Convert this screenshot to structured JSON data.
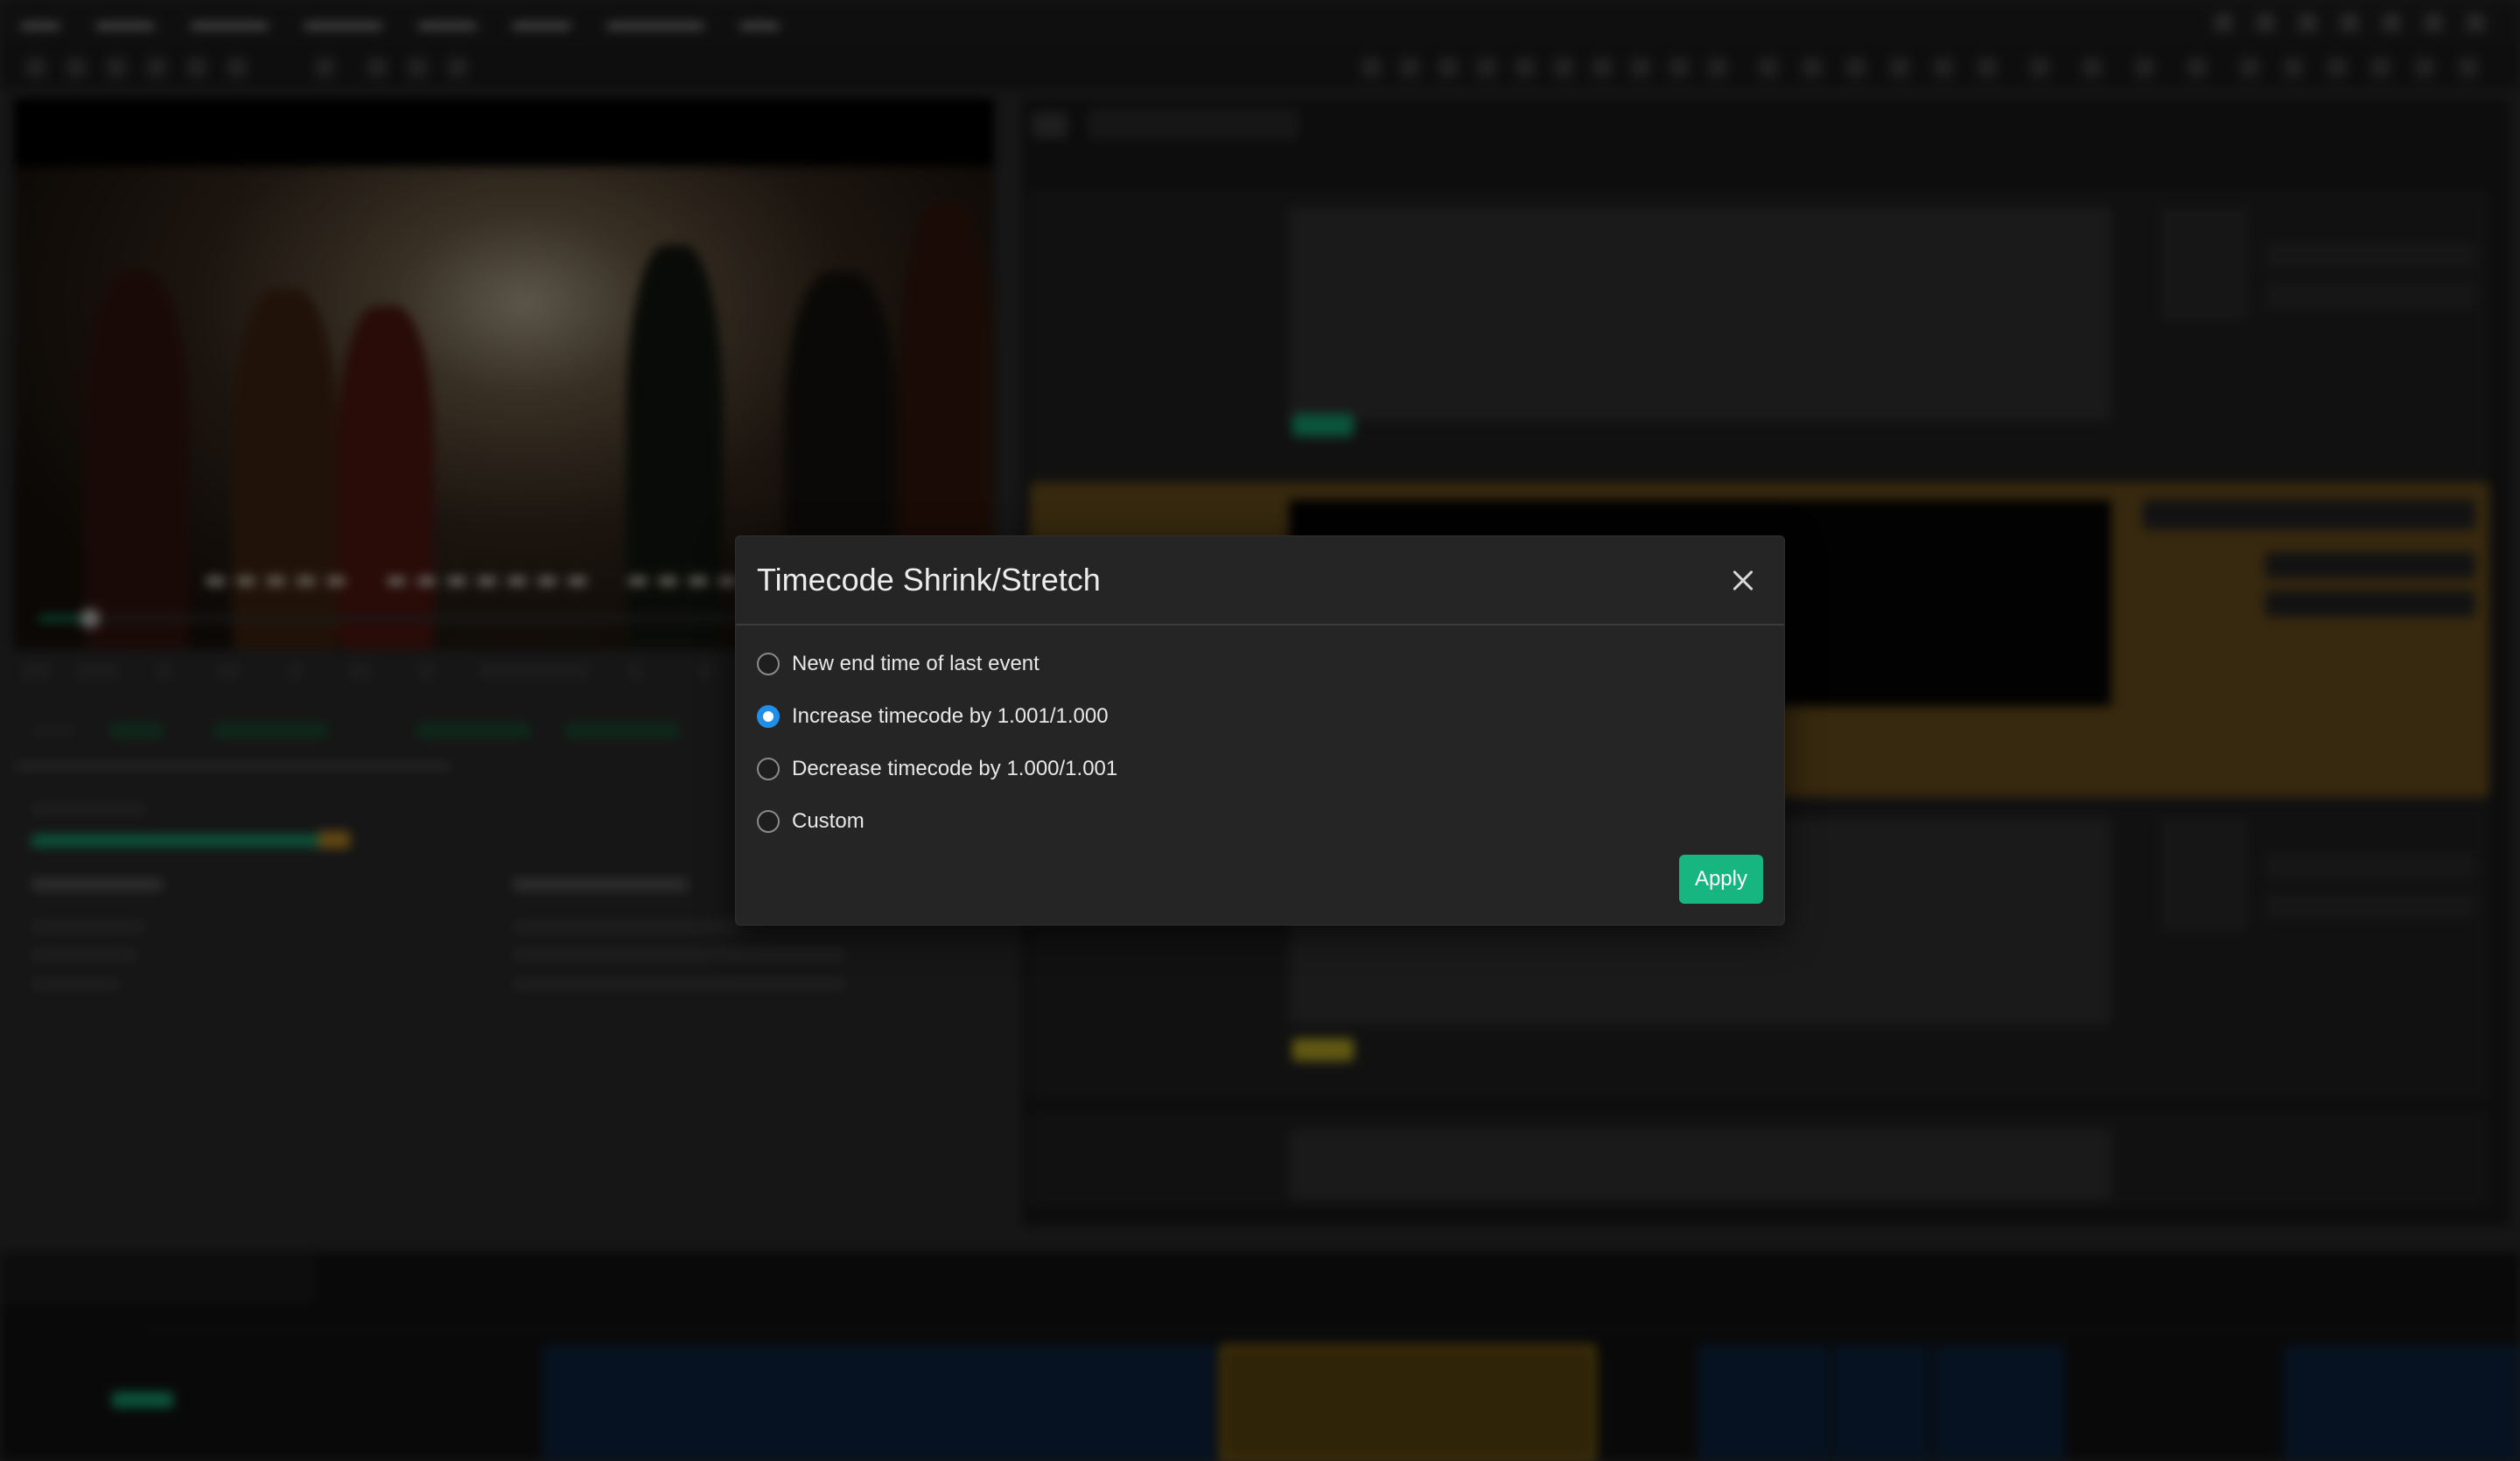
{
  "dialog": {
    "title": "Timecode Shrink/Stretch",
    "options": [
      {
        "label": "New end time of last event",
        "checked": false
      },
      {
        "label": "Increase timecode by 1.001/1.000",
        "checked": true
      },
      {
        "label": "Decrease timecode by 1.000/1.001",
        "checked": false
      },
      {
        "label": "Custom",
        "checked": false
      }
    ],
    "apply_label": "Apply"
  },
  "colors": {
    "accent_green": "#17b57f",
    "radio_selected": "#1f8fe8",
    "selected_event": "#7a5a22"
  }
}
